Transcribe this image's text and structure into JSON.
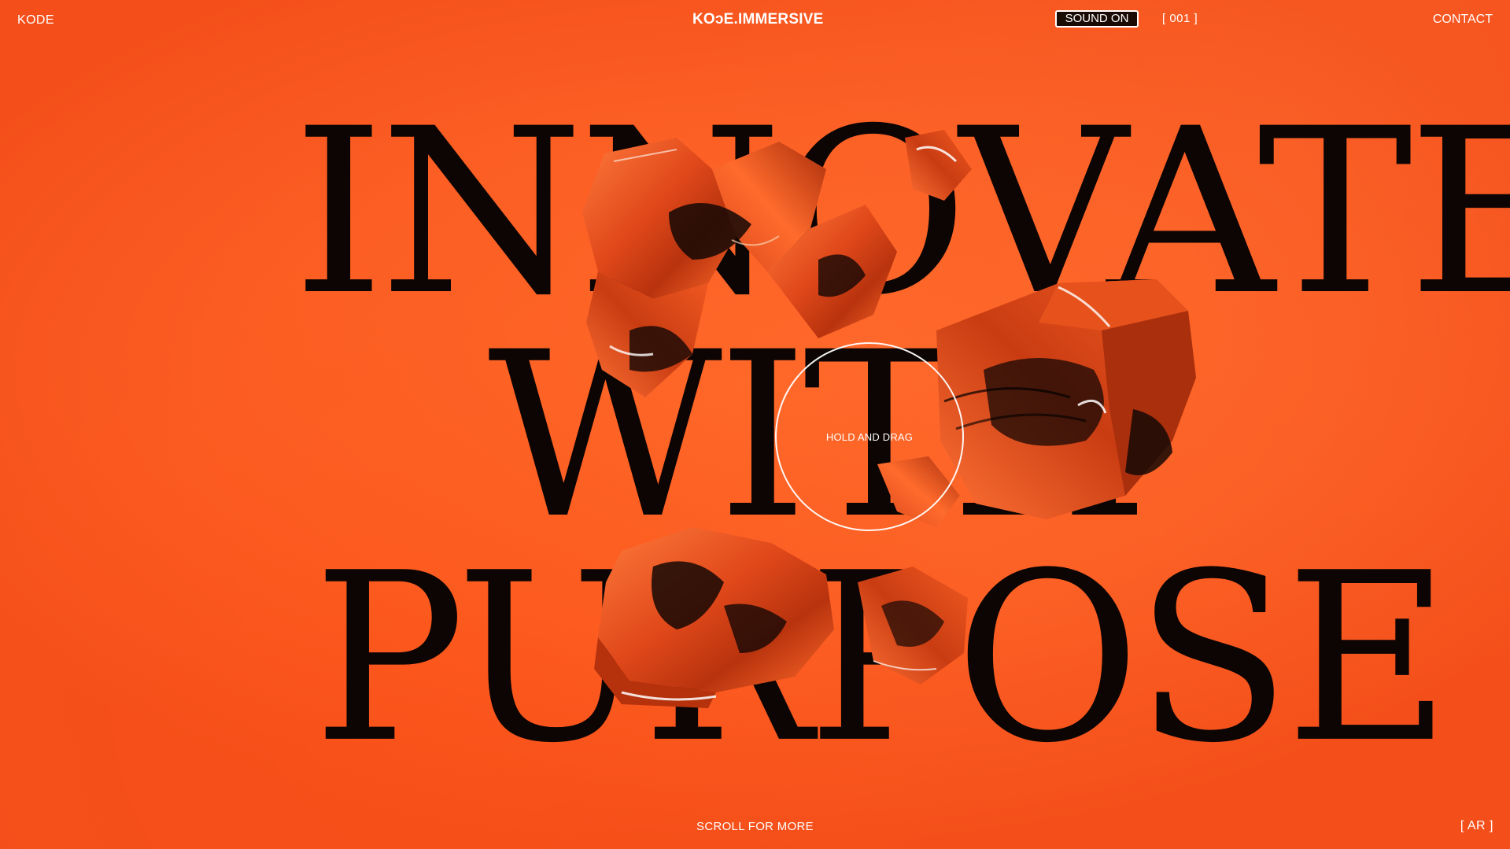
{
  "colors": {
    "background": "#fc5f24",
    "headline": "#0c0503",
    "ui_text": "#ffffff",
    "object_base": "#e04a16"
  },
  "header": {
    "brand_left": "KODE",
    "brand_center": "KOɔE.IMMERSIVE",
    "sound_toggle": "SOUND ON",
    "counter": "[ 001 ]",
    "contact": "CONTACT"
  },
  "hero": {
    "line1": "INNOVATE",
    "line2": "WITH",
    "line3": "PURPOSE",
    "drag_hint": "HOLD AND DRAG"
  },
  "footer": {
    "scroll_hint": "SCROLL FOR MORE",
    "language": "[ AR ]"
  }
}
